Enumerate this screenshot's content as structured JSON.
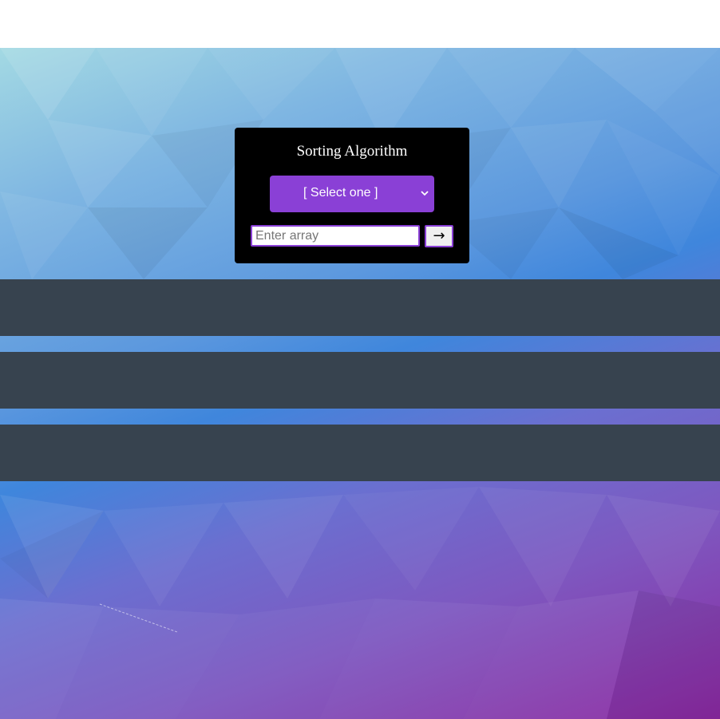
{
  "card": {
    "title": "Sorting Algorithm",
    "select": {
      "selected_label": "[ Select one ]"
    },
    "input": {
      "placeholder": "Enter array",
      "value": ""
    },
    "submit_label": "→"
  },
  "colors": {
    "card_background": "#000000",
    "accent": "#8a40d6",
    "bar": "#37434f"
  },
  "icons": {
    "select_chevron": "chevron-down-icon",
    "submit_arrow": "arrow-right-icon"
  }
}
